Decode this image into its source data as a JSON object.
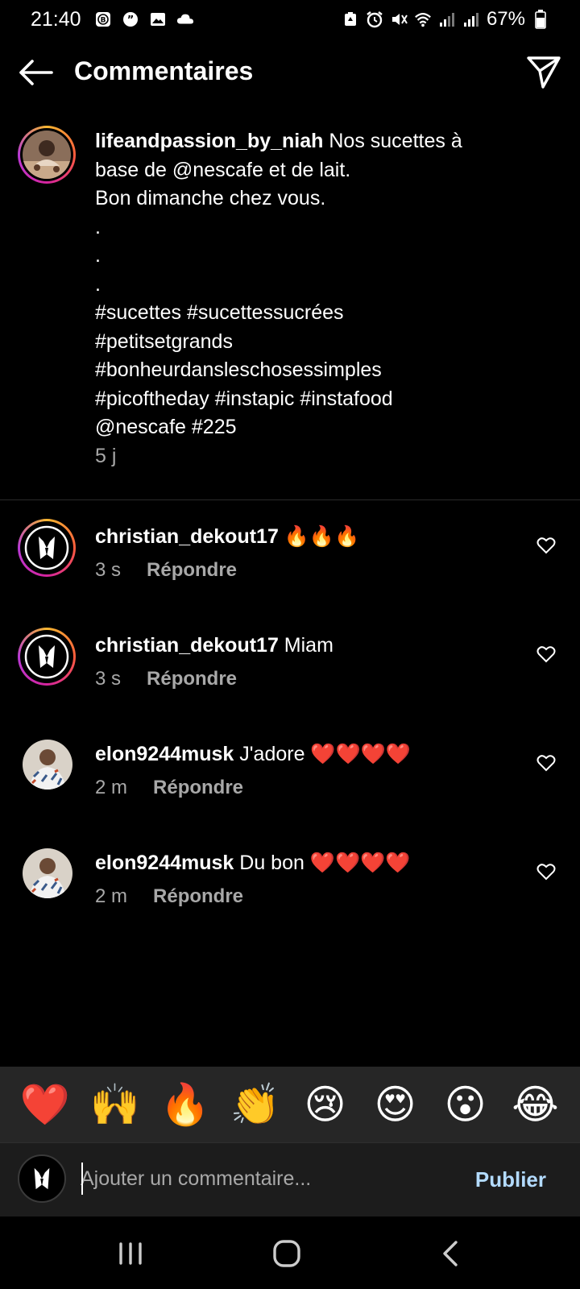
{
  "status_bar": {
    "time": "21:40",
    "battery": "67%"
  },
  "header": {
    "title": "Commentaires"
  },
  "caption": {
    "username": "lifeandpassion_by_niah",
    "lines": [
      " Nos sucettes à",
      "base de @nescafe et de lait.",
      "Bon dimanche chez vous.",
      ".",
      ".",
      ".",
      "#sucettes #sucettessucrées",
      "#petitsetgrands",
      "#bonheurdansleschosessimples",
      "#picoftheday #instapic #instafood",
      "@nescafe #225"
    ],
    "time": "5 j"
  },
  "comments": [
    {
      "username": "christian_dekout17",
      "text": " 🔥🔥🔥",
      "time": "3 s",
      "reply_label": "Répondre"
    },
    {
      "username": "christian_dekout17",
      "text": " Miam",
      "time": "3 s",
      "reply_label": "Répondre"
    },
    {
      "username": "elon9244musk",
      "text": " J'adore ❤️❤️❤️❤️",
      "time": "2 m",
      "reply_label": "Répondre"
    },
    {
      "username": "elon9244musk",
      "text": " Du bon ❤️❤️❤️❤️",
      "time": "2 m",
      "reply_label": "Répondre"
    }
  ],
  "emoji_bar": [
    "❤️",
    "🙌",
    "🔥",
    "👏",
    "😢",
    "😍",
    "😮",
    "😂"
  ],
  "input": {
    "placeholder": "Ajouter un commentaire...",
    "publish_label": "Publier"
  },
  "colors": {
    "background": "#000000",
    "secondary_text": "#a8a8a8",
    "publish": "#b3dbff",
    "emoji_bar_bg": "#262626"
  }
}
